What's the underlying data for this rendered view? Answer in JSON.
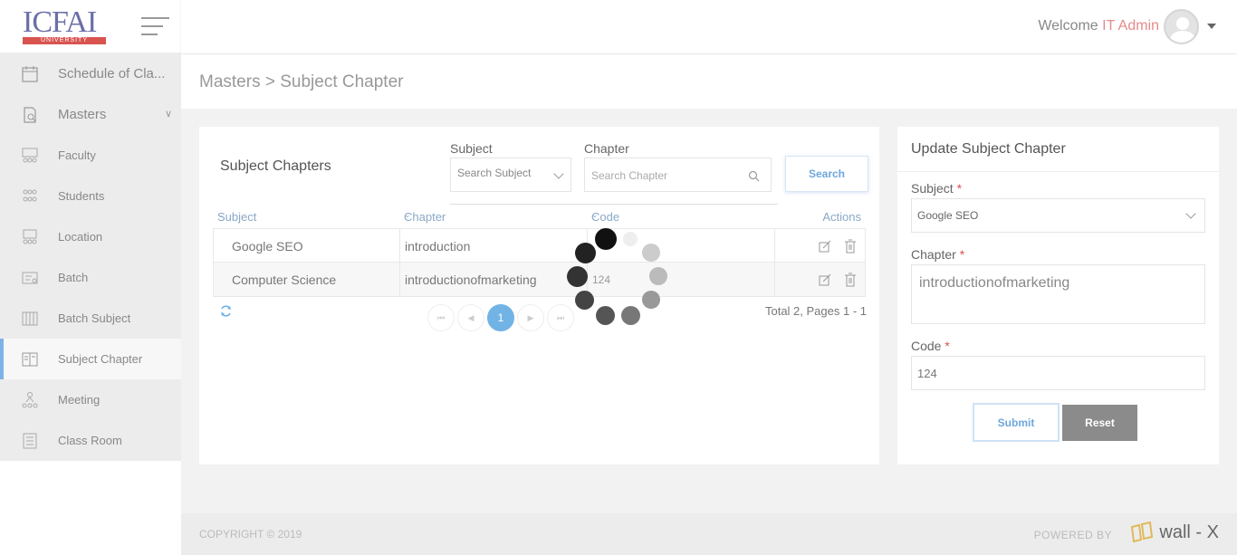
{
  "brand": {
    "logo_text": "ICFAI",
    "logo_sub": "UNIVERSITY"
  },
  "sidebar": {
    "items": [
      {
        "label": "Schedule of Cla...",
        "icon": "calendar-icon"
      },
      {
        "label": "Masters",
        "icon": "document-search-icon"
      },
      {
        "label": "Faculty",
        "icon": "faculty-icon"
      },
      {
        "label": "Students",
        "icon": "students-icon"
      },
      {
        "label": "Location",
        "icon": "location-icon"
      },
      {
        "label": "Batch",
        "icon": "batch-icon"
      },
      {
        "label": "Batch Subject",
        "icon": "batch-subject-icon"
      },
      {
        "label": "Subject Chapter",
        "icon": "book-icon"
      },
      {
        "label": "Meeting",
        "icon": "meeting-icon"
      },
      {
        "label": "Class Room",
        "icon": "classroom-icon"
      }
    ]
  },
  "header": {
    "welcome": "Welcome",
    "user": "IT Admin"
  },
  "breadcrumb": "Masters > Subject Chapter",
  "list": {
    "title": "Subject Chapters",
    "subject_label": "Subject",
    "subject_placeholder": "Search Subject",
    "chapter_label": "Chapter",
    "chapter_placeholder": "Search Chapter",
    "search_button": "Search",
    "columns": {
      "subject": "Subject",
      "chapter": "Chapter",
      "code": "Code",
      "actions": "Actions"
    },
    "rows": [
      {
        "subject": "Google SEO",
        "chapter": "introduction",
        "code": ""
      },
      {
        "subject": "Computer Science",
        "chapter": "introductionofmarketing",
        "code": "124"
      }
    ],
    "pagination": {
      "current": "1",
      "total_text": "Total 2, Pages 1 - 1"
    }
  },
  "form": {
    "title": "Update Subject Chapter",
    "subject_label": "Subject",
    "subject_value": "Google SEO",
    "chapter_label": "Chapter",
    "chapter_value": "introductionofmarketing",
    "code_label": "Code",
    "code_value": "124",
    "required_mark": "*",
    "submit": "Submit",
    "reset": "Reset"
  },
  "footer": {
    "copyright": "COPYRIGHT © 2019",
    "powered_by": "POWERED BY",
    "vendor": "wall - X"
  },
  "colors": {
    "accent": "#72b3e6",
    "user_name": "#e48a8a",
    "required": "#d9534f"
  }
}
